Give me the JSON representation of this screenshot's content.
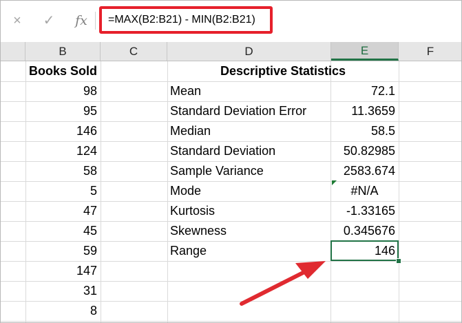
{
  "formula_bar": {
    "cancel_icon": "×",
    "enter_icon": "✓",
    "fx_label": "fx",
    "formula": "=MAX(B2:B21) - MIN(B2:B21)"
  },
  "columns": [
    "B",
    "C",
    "D",
    "E",
    "F"
  ],
  "selected_column": "E",
  "cells": {
    "b_header": "Books Sold",
    "d_header": "Descriptive Statistics",
    "books_sold": [
      "98",
      "95",
      "146",
      "124",
      "58",
      "5",
      "47",
      "45",
      "59",
      "147",
      "31",
      "8"
    ],
    "stats": [
      {
        "label": "Mean",
        "value": "72.1"
      },
      {
        "label": "Standard Deviation Error",
        "value": "11.3659"
      },
      {
        "label": "Median",
        "value": "58.5"
      },
      {
        "label": "Standard Deviation",
        "value": "50.82985"
      },
      {
        "label": "Sample Variance",
        "value": "2583.674"
      },
      {
        "label": "Mode",
        "value": "#N/A"
      },
      {
        "label": "Kurtosis",
        "value": "-1.33165"
      },
      {
        "label": "Skewness",
        "value": "0.345676"
      },
      {
        "label": "Range",
        "value": "146"
      }
    ]
  },
  "colors": {
    "highlight_border": "#e6202b",
    "selection": "#217346",
    "arrow": "#e02a30"
  }
}
